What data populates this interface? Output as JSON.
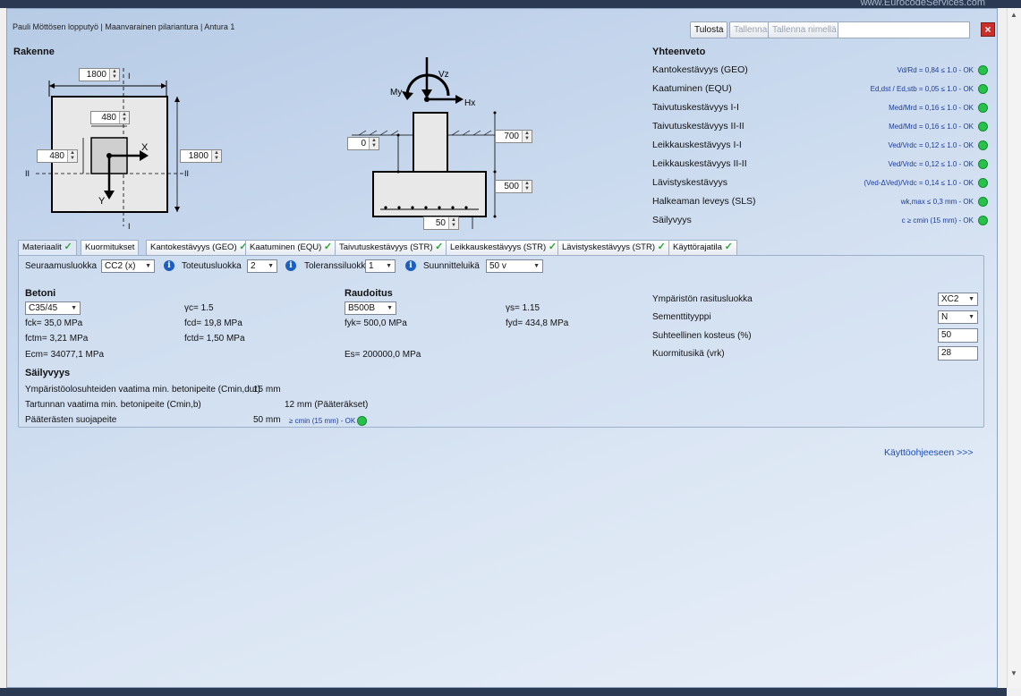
{
  "window": {
    "url_hint": "www.EurocodeServices.com",
    "title": "Pauli Möttösen lopputyö | Maanvarainen pilariantura | Antura 1"
  },
  "toolbar": {
    "print_label": "Tulosta",
    "save_label": "Tallenna",
    "save_as_label": "Tallenna nimellä",
    "name_value": ""
  },
  "structure": {
    "title": "Rakenne",
    "plan": {
      "width_x": "1800",
      "width_y": "1800",
      "pillar_x": "480",
      "pillar_y": "480",
      "axis_x": "X",
      "axis_y": "Y",
      "section_I": "I",
      "section_II": "II"
    },
    "elevation": {
      "load_vz": "Vz",
      "load_my": "My",
      "load_hx": "Hx",
      "offset": "0",
      "pillar_height": "700",
      "footing_height": "500",
      "cover": "50"
    }
  },
  "summary": {
    "title": "Yhteenveto",
    "rows": [
      {
        "label": "Kantokestävyys (GEO)",
        "status": "Vd/Rd = 0,84 ≤ 1.0 - OK"
      },
      {
        "label": "Kaatuminen (EQU)",
        "status": "Ed,dst / Ed,stb = 0,05 ≤ 1.0 - OK"
      },
      {
        "label": "Taivutuskestävyys I-I",
        "status": "Med/Mrd = 0,16 ≤ 1.0 - OK"
      },
      {
        "label": "Taivutuskestävyys II-II",
        "status": "Med/Mrd = 0,16 ≤ 1.0 - OK"
      },
      {
        "label": "Leikkauskestävyys I-I",
        "status": "Ved/Vrdc = 0,12 ≤ 1.0 - OK"
      },
      {
        "label": "Leikkauskestävyys II-II",
        "status": "Ved/Vrdc = 0,12 ≤ 1.0 - OK"
      },
      {
        "label": "Lävistyskestävyys",
        "status": "(Ved-ΔVed)/Vrdc = 0,14 ≤ 1.0 - OK"
      },
      {
        "label": "Halkeaman leveys (SLS)",
        "status": "wk,max ≤ 0,3 mm - OK"
      },
      {
        "label": "Säilyvyys",
        "status": "c ≥ cmin (15 mm) - OK"
      }
    ],
    "status_color": "#27c24a"
  },
  "tabs": [
    {
      "label": "Materiaalit"
    },
    {
      "label": "Kuormitukset"
    },
    {
      "label": "Kantokestävyys (GEO)"
    },
    {
      "label": "Kaatuminen (EQU)"
    },
    {
      "label": "Taivutuskestävyys (STR)"
    },
    {
      "label": "Leikkauskestävyys (STR)"
    },
    {
      "label": "Lävistyskestävyys (STR)"
    },
    {
      "label": "Käyttörajatila"
    }
  ],
  "materials": {
    "consequence_class_label": "Seuraamusluokka",
    "consequence_class_value": "CC2 (x)",
    "execution_class_label": "Toteutusluokka",
    "execution_class_value": "2",
    "tolerance_class_label": "Toleranssiluokka",
    "tolerance_class_value": "1",
    "design_life_label": "Suunnitteluikä",
    "design_life_value": "50 v",
    "concrete": {
      "title": "Betoni",
      "grade": "C35/45",
      "gamma_c": "γc=  1.5",
      "fck": "fck=   35,0 MPa",
      "fcd": "fcd=   19,8 MPa",
      "fctm": "fctm=  3,21 MPa",
      "fctd": "fctd=  1,50 MPa",
      "ecm": "Ecm=  34077,1 MPa"
    },
    "reinforcement": {
      "title": "Raudoitus",
      "grade": "B500B",
      "gamma_s": "γs=  1.15",
      "fyk": "fyk=  500,0 MPa",
      "fyd": "fyd=  434,8 MPa",
      "es": "Es=  200000,0 MPa"
    },
    "environment": {
      "exposure_label": "Ympäristön rasitusluokka",
      "exposure_value": "XC2",
      "cement_label": "Sementtityyppi",
      "cement_value": "N",
      "humidity_label": "Suhteellinen kosteus (%)",
      "humidity_value": "50",
      "age_label": "Kuormitusikä (vrk)",
      "age_value": "28"
    },
    "durability": {
      "title": "Säilyvyys",
      "row1_label": "Ympäristöolosuhteiden vaatima min. betonipeite (Cmin,dur)",
      "row1_value": "15 mm",
      "row2_label": "Tartunnan vaatima min. betonipeite (Cmin,b)",
      "row2_value": "12 mm  (Pääteräkset)",
      "row3_label": "Pääterästen suojapeite",
      "row3_value": "50 mm",
      "row3_status": "≥ cmin (15 mm) - OK"
    }
  },
  "help_link": "Käyttöohjeeseen >>>"
}
